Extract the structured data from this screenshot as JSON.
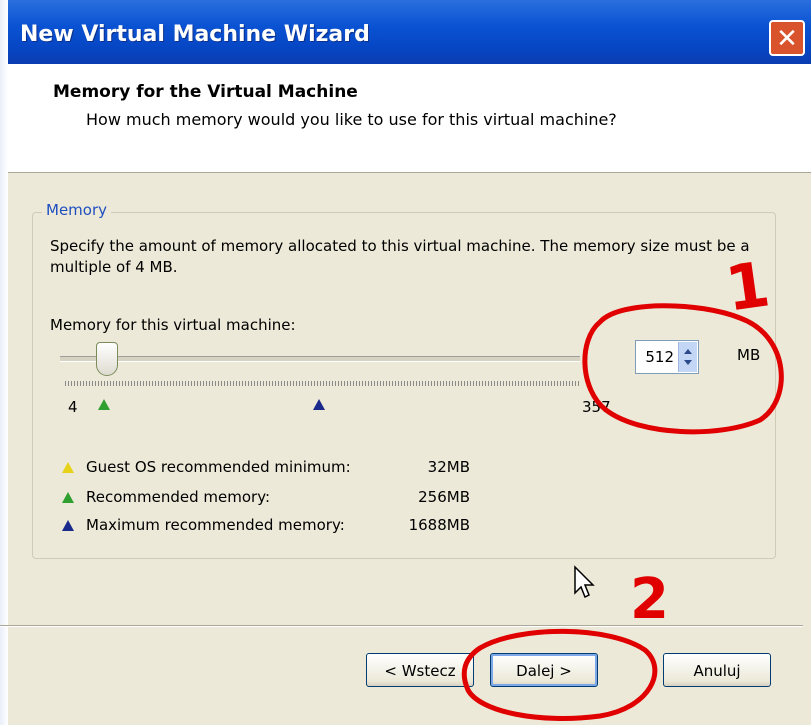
{
  "window": {
    "title": "New Virtual Machine Wizard",
    "close_glyph": "✕"
  },
  "header": {
    "title": "Memory for the Virtual Machine",
    "subtitle": "How much memory would you like to use for this virtual machine?"
  },
  "memory_group": {
    "label": "Memory",
    "description": "Specify the amount of memory allocated to this virtual machine. The memory size must be a multiple of 4 MB.",
    "field_label": "Memory for this virtual machine:",
    "value": "512",
    "unit": "MB",
    "slider": {
      "min_label": "4",
      "max_label": "357",
      "value": 512,
      "min": 4,
      "max": 3576
    },
    "legend": [
      {
        "label": "Guest OS recommended minimum:",
        "value": "32MB",
        "color": "#e7d21a",
        "icon": "triangle-yellow-outline"
      },
      {
        "label": "Recommended memory:",
        "value": "256MB",
        "color": "#2f9f2f",
        "icon": "triangle-green"
      },
      {
        "label": "Maximum recommended memory:",
        "value": "1688MB",
        "color": "#1a2a8c",
        "icon": "triangle-navy"
      }
    ]
  },
  "buttons": {
    "back": "< Wstecz",
    "next": "Dalej >",
    "cancel": "Anuluj"
  },
  "annotations": {
    "mark_1": "1",
    "mark_2": "2",
    "color": "#e00000"
  }
}
